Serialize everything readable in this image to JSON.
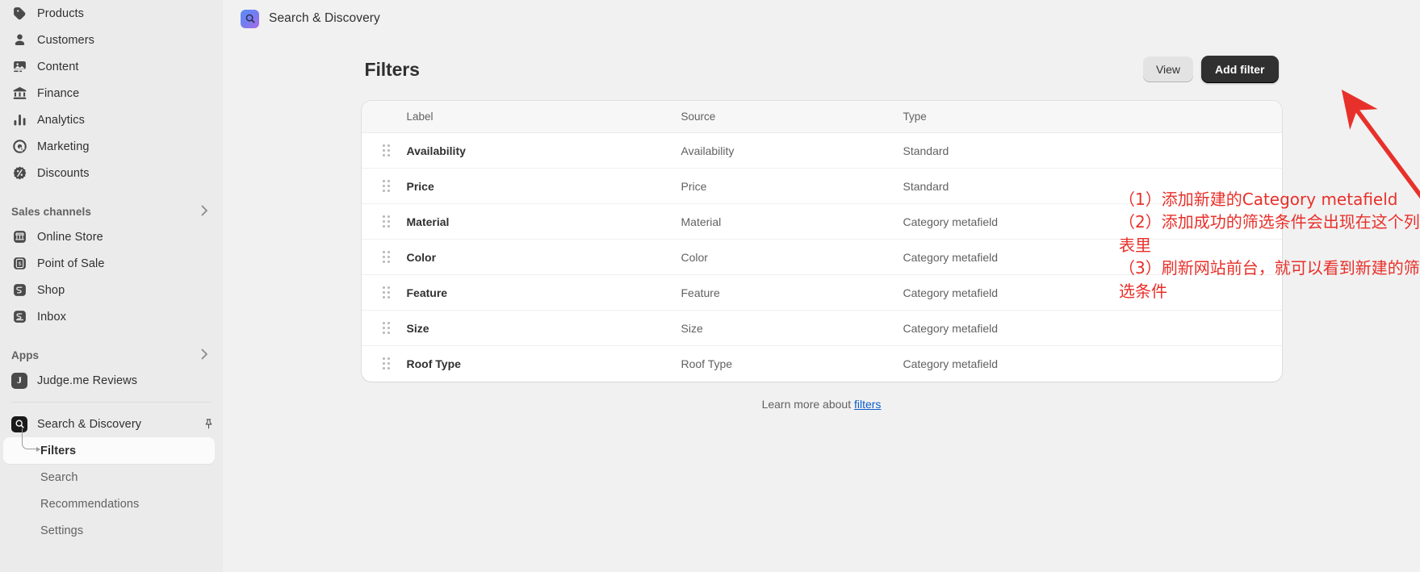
{
  "sidebar": {
    "main_items": [
      {
        "label": "Products",
        "icon": "tag-icon"
      },
      {
        "label": "Customers",
        "icon": "person-icon"
      },
      {
        "label": "Content",
        "icon": "image-icon"
      },
      {
        "label": "Finance",
        "icon": "bank-icon"
      },
      {
        "label": "Analytics",
        "icon": "bar-chart-icon"
      },
      {
        "label": "Marketing",
        "icon": "target-icon"
      },
      {
        "label": "Discounts",
        "icon": "discount-icon"
      }
    ],
    "sales_channels": {
      "heading": "Sales channels",
      "items": [
        {
          "label": "Online Store",
          "icon": "storefront-icon"
        },
        {
          "label": "Point of Sale",
          "icon": "pos-icon"
        },
        {
          "label": "Shop",
          "icon": "shop-icon"
        },
        {
          "label": "Inbox",
          "icon": "inbox-icon"
        }
      ]
    },
    "apps": {
      "heading": "Apps",
      "items": [
        {
          "label": "Judge.me Reviews",
          "icon": "judgeme-icon",
          "badge": "J"
        }
      ]
    },
    "current_app": {
      "label": "Search & Discovery",
      "icon": "search-app-icon",
      "pin": "pin-icon",
      "children": [
        {
          "label": "Filters",
          "active": true
        },
        {
          "label": "Search",
          "active": false
        },
        {
          "label": "Recommendations",
          "active": false
        },
        {
          "label": "Settings",
          "active": false
        }
      ]
    }
  },
  "topbar": {
    "app_title": "Search & Discovery",
    "app_icon": "search-magnifier-icon"
  },
  "page": {
    "title": "Filters",
    "view_button": "View",
    "add_filter_button": "Add filter",
    "learn_prefix": "Learn more about ",
    "learn_link": "filters"
  },
  "table": {
    "columns": [
      "Label",
      "Source",
      "Type"
    ],
    "rows": [
      {
        "label": "Availability",
        "source": "Availability",
        "type": "Standard"
      },
      {
        "label": "Price",
        "source": "Price",
        "type": "Standard"
      },
      {
        "label": "Material",
        "source": "Material",
        "type": "Category metafield"
      },
      {
        "label": "Color",
        "source": "Color",
        "type": "Category metafield"
      },
      {
        "label": "Feature",
        "source": "Feature",
        "type": "Category metafield"
      },
      {
        "label": "Size",
        "source": "Size",
        "type": "Category metafield"
      },
      {
        "label": "Roof Type",
        "source": "Roof Type",
        "type": "Category metafield"
      }
    ]
  },
  "annotations": {
    "color": "#e8302a",
    "text": "（1）添加新建的Category metafield\n（2）添加成功的筛选条件会出现在这个列表里\n（3）刷新网站前台，就可以看到新建的筛选条件",
    "arrow": "red-arrow-pointing-to-add-filter-button"
  }
}
